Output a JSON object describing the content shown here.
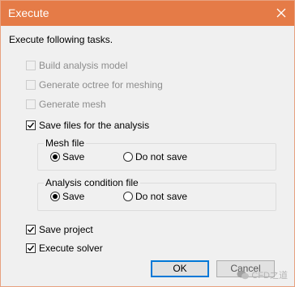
{
  "window": {
    "title": "Execute",
    "accent": "#e57b47"
  },
  "intro": "Execute following tasks.",
  "tasks": [
    {
      "label": "Build analysis model",
      "checked": false,
      "enabled": false
    },
    {
      "label": "Generate octree for meshing",
      "checked": false,
      "enabled": false
    },
    {
      "label": "Generate mesh",
      "checked": false,
      "enabled": false
    },
    {
      "label": "Save files for the analysis",
      "checked": true,
      "enabled": true
    }
  ],
  "mesh_file": {
    "legend": "Mesh file",
    "options": [
      "Save",
      "Do not save"
    ],
    "selected": "Save"
  },
  "analysis_file": {
    "legend": "Analysis condition file",
    "options": [
      "Save",
      "Do not save"
    ],
    "selected": "Save"
  },
  "save_project": {
    "label": "Save project",
    "checked": true
  },
  "execute_solver": {
    "label": "Execute solver",
    "checked": true
  },
  "buttons": {
    "ok": "OK",
    "cancel": "Cancel"
  },
  "watermark": "CFD之道"
}
